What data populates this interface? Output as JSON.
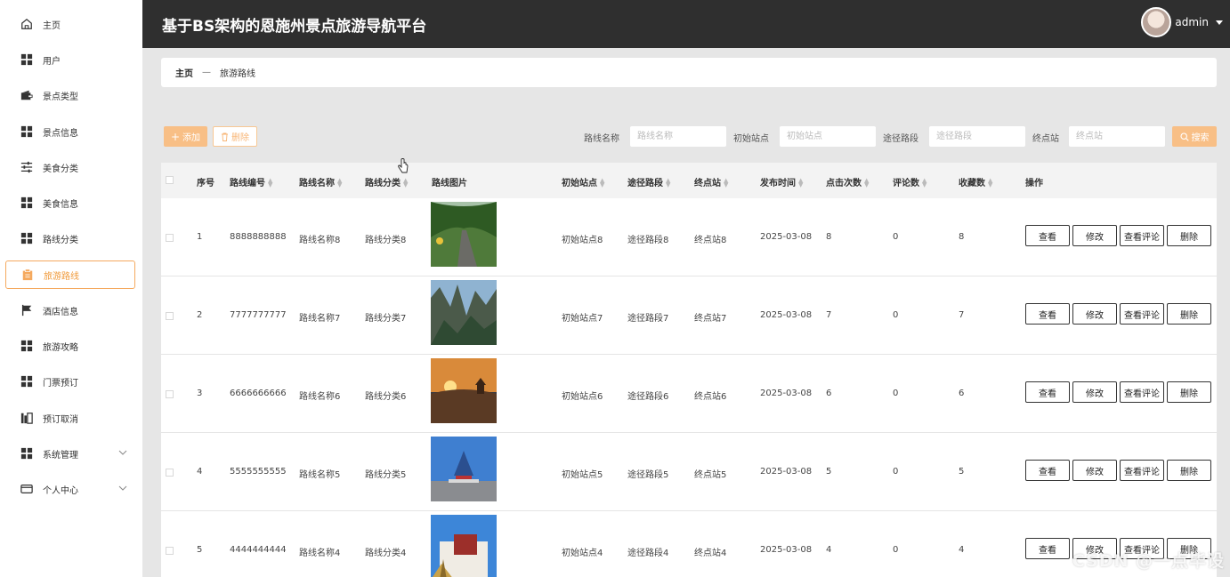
{
  "app": {
    "title": "基于BS架构的恩施州景点旅游导航平台"
  },
  "user": {
    "name": "admin"
  },
  "sidebar": {
    "items": [
      {
        "label": "主页",
        "icon": "home-icon"
      },
      {
        "label": "用户",
        "icon": "grid-icon"
      },
      {
        "label": "景点类型",
        "icon": "wallet-icon"
      },
      {
        "label": "景点信息",
        "icon": "grid-icon"
      },
      {
        "label": "美食分类",
        "icon": "sliders-icon"
      },
      {
        "label": "美食信息",
        "icon": "grid-icon"
      },
      {
        "label": "路线分类",
        "icon": "grid-icon"
      },
      {
        "label": "旅游路线",
        "icon": "clipboard-icon",
        "active": true
      },
      {
        "label": "酒店信息",
        "icon": "flag-icon"
      },
      {
        "label": "旅游攻略",
        "icon": "grid-icon"
      },
      {
        "label": "门票预订",
        "icon": "grid-icon"
      },
      {
        "label": "预订取消",
        "icon": "chart-icon"
      },
      {
        "label": "系统管理",
        "icon": "grid-icon",
        "expandable": true
      },
      {
        "label": "个人中心",
        "icon": "card-icon",
        "expandable": true
      }
    ]
  },
  "breadcrumb": {
    "home": "主页",
    "separator": "—",
    "current": "旅游路线"
  },
  "toolbar": {
    "add_label": "添加",
    "delete_label": "删除",
    "search_label": "搜索"
  },
  "filters": [
    {
      "label": "路线名称",
      "placeholder": "路线名称"
    },
    {
      "label": "初始站点",
      "placeholder": "初始站点"
    },
    {
      "label": "途径路段",
      "placeholder": "途径路段"
    },
    {
      "label": "终点站",
      "placeholder": "终点站"
    }
  ],
  "table": {
    "headers": {
      "index": "序号",
      "code": "路线编号",
      "name": "路线名称",
      "category": "路线分类",
      "image": "路线图片",
      "start": "初始站点",
      "via": "途径路段",
      "end": "终点站",
      "date": "发布时间",
      "clicks": "点击次数",
      "comments": "评论数",
      "favorites": "收藏数",
      "actions": "操作"
    },
    "action_labels": {
      "view": "查看",
      "edit": "修改",
      "view_comments": "查看评论",
      "delete": "删除"
    },
    "rows": [
      {
        "index": "1",
        "code": "8888888888",
        "name": "路线名称8",
        "category": "路线分类8",
        "image": "tree-tunnel-road",
        "start": "初始站点8",
        "via": "途径路段8",
        "end": "终点站8",
        "date": "2025-03-08",
        "clicks": "8",
        "comments": "0",
        "favorites": "8"
      },
      {
        "index": "2",
        "code": "7777777777",
        "name": "路线名称7",
        "category": "路线分类7",
        "image": "mountain-gorge",
        "start": "初始站点7",
        "via": "途径路段7",
        "end": "终点站7",
        "date": "2025-03-08",
        "clicks": "7",
        "comments": "0",
        "favorites": "7"
      },
      {
        "index": "3",
        "code": "6666666666",
        "name": "路线名称6",
        "category": "路线分类6",
        "image": "sunset-temple",
        "start": "初始站点6",
        "via": "途径路段6",
        "end": "终点站6",
        "date": "2025-03-08",
        "clicks": "6",
        "comments": "0",
        "favorites": "6"
      },
      {
        "index": "4",
        "code": "5555555555",
        "name": "路线名称5",
        "category": "路线分类5",
        "image": "temple-of-heaven",
        "start": "初始站点5",
        "via": "途径路段5",
        "end": "终点站5",
        "date": "2025-03-08",
        "clicks": "5",
        "comments": "0",
        "favorites": "5"
      },
      {
        "index": "5",
        "code": "4444444444",
        "name": "路线名称4",
        "category": "路线分类4",
        "image": "potala-palace",
        "start": "初始站点4",
        "via": "途径路段4",
        "end": "终点站4",
        "date": "2025-03-08",
        "clicks": "4",
        "comments": "0",
        "favorites": "4"
      }
    ]
  },
  "watermark": "CSDN @一点毕设",
  "colors": {
    "accent": "#f8bf86",
    "header_bg": "#2f2f2f",
    "active_border": "#f5a95e"
  }
}
